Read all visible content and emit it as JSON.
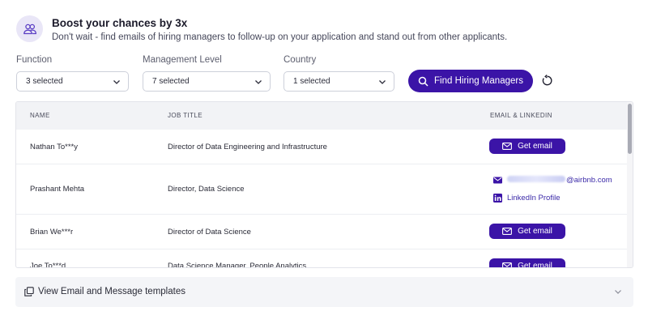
{
  "banner": {
    "icon": "users-icon",
    "title": "Boost your chances by 3x",
    "subtitle": "Don't wait - find emails of hiring managers to follow-up on your application and stand out from other applicants."
  },
  "filters": {
    "function": {
      "label": "Function",
      "value": "3 selected"
    },
    "management_level": {
      "label": "Management Level",
      "value": "7 selected"
    },
    "country": {
      "label": "Country",
      "value": "1 selected"
    },
    "find_button": "Find Hiring Managers"
  },
  "table": {
    "headers": {
      "name": "NAME",
      "job_title": "JOB TITLE",
      "email_linkedin": "EMAIL & LINKEDIN"
    },
    "get_email_label": "Get email",
    "rows": [
      {
        "name": "Nathan To***y",
        "job_title": "Director of Data Engineering and Infrastructure"
      },
      {
        "name": "Prashant Mehta",
        "job_title": "Director, Data Science",
        "email_domain": "@airbnb.com",
        "linkedin": "LinkedIn Profile"
      },
      {
        "name": "Brian We***r",
        "job_title": "Director of Data Science"
      },
      {
        "name": "Joe To***d",
        "job_title": "Data Science Manager, People Analytics"
      }
    ]
  },
  "templates": {
    "label": "View Email and Message templates"
  },
  "colors": {
    "accent": "#3b14a7",
    "link": "#3b2aa8",
    "banner_icon_bg": "#e9e6f7"
  }
}
